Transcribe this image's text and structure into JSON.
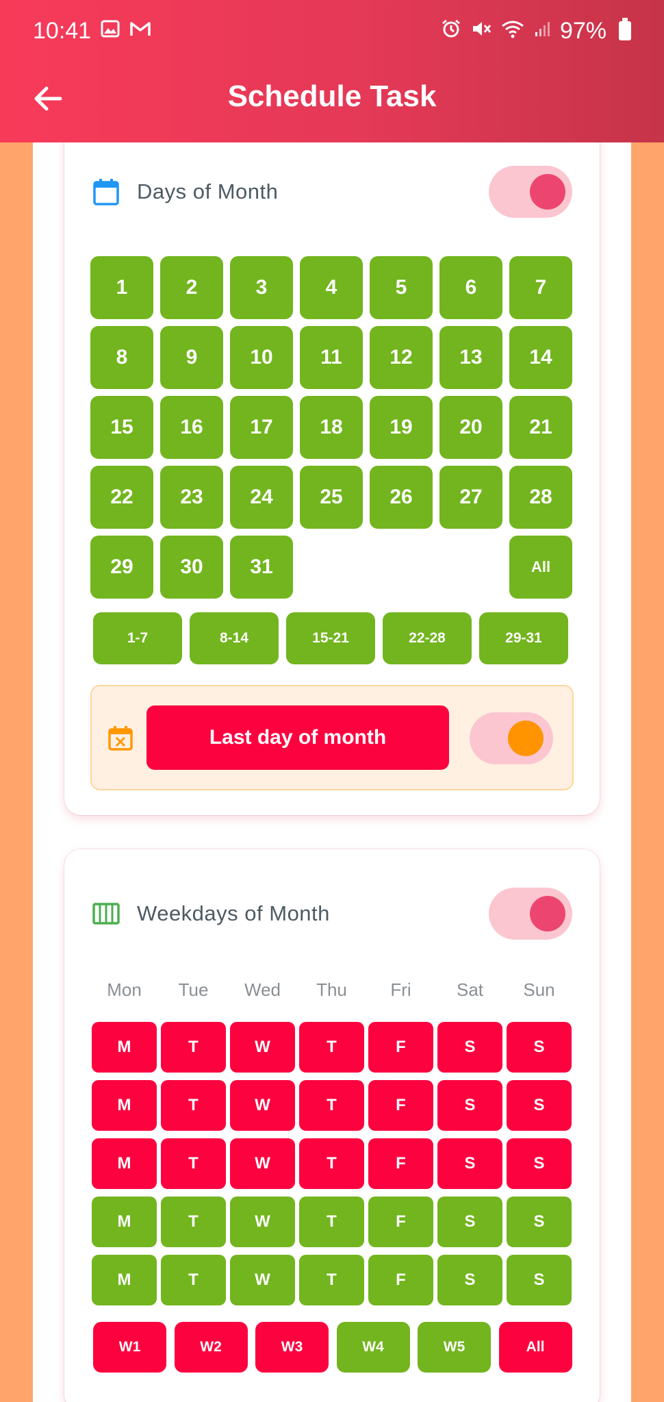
{
  "status_bar": {
    "time": "10:41",
    "battery": "97%"
  },
  "toolbar": {
    "title": "Schedule Task"
  },
  "days_card": {
    "title": "Days of Month",
    "enabled": true,
    "days": [
      "1",
      "2",
      "3",
      "4",
      "5",
      "6",
      "7",
      "8",
      "9",
      "10",
      "11",
      "12",
      "13",
      "14",
      "15",
      "16",
      "17",
      "18",
      "19",
      "20",
      "21",
      "22",
      "23",
      "24",
      "25",
      "26",
      "27",
      "28",
      "29",
      "30",
      "31"
    ],
    "all_label": "All",
    "ranges": [
      "1-7",
      "8-14",
      "15-21",
      "22-28",
      "29-31"
    ],
    "last_day": {
      "label": "Last day of month",
      "enabled": true
    }
  },
  "weekdays_card": {
    "title": "Weekdays of Month",
    "enabled": true,
    "headers": [
      "Mon",
      "Tue",
      "Wed",
      "Thu",
      "Fri",
      "Sat",
      "Sun"
    ],
    "letters": [
      "M",
      "T",
      "W",
      "T",
      "F",
      "S",
      "S"
    ],
    "row_states": [
      "red",
      "red",
      "red",
      "green",
      "green"
    ],
    "week_buttons": [
      {
        "label": "W1",
        "state": "red"
      },
      {
        "label": "W2",
        "state": "red"
      },
      {
        "label": "W3",
        "state": "red"
      },
      {
        "label": "W4",
        "state": "green"
      },
      {
        "label": "W5",
        "state": "green"
      },
      {
        "label": "All",
        "state": "red"
      }
    ]
  },
  "colors": {
    "selected_green": "#72B51E",
    "unselected_red": "#FC0340",
    "toggle_knob": "#EC4670",
    "last_day_knob": "#FF9400"
  }
}
